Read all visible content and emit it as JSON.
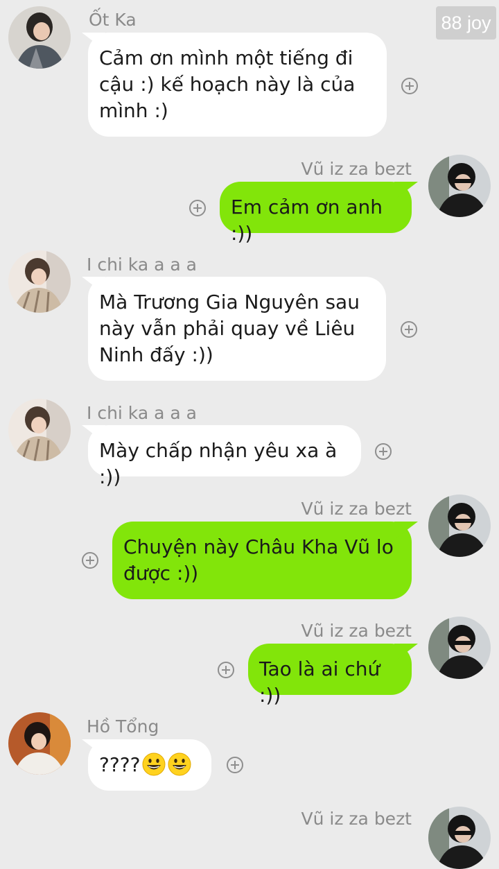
{
  "watermark": "88 joy",
  "messages": [
    {
      "sender": "Ốt Ka",
      "text": "Cảm ơn mình một tiếng đi\ncậu :) kế hoạch này là của\nmình :)"
    },
    {
      "sender": "Vũ iz za bezt",
      "text": "Em cảm ơn anh :))"
    },
    {
      "sender": "I chi ka a a a",
      "text": "Mà Trương Gia Nguyên sau\nnày vẫn phải quay về Liêu\nNinh đấy :))"
    },
    {
      "sender": "I chi ka a a a",
      "text": "Mày chấp nhận yêu xa à :))"
    },
    {
      "sender": "Vũ iz za bezt",
      "text": "Chuyện này Châu Kha Vũ lo\nđược :))"
    },
    {
      "sender": "Vũ iz za bezt",
      "text": "Tao là ai chứ :))"
    },
    {
      "sender": "Hồ Tổng",
      "text": "????",
      "emojis": [
        "grinning-face-emoji",
        "grinning-face-emoji"
      ]
    },
    {
      "sender": "Vũ iz za bezt"
    }
  ],
  "colors": {
    "background": "#ebebeb",
    "incoming_bubble": "#ffffff",
    "outgoing_bubble": "#82e50a",
    "sender_name": "#8a8a8a"
  }
}
